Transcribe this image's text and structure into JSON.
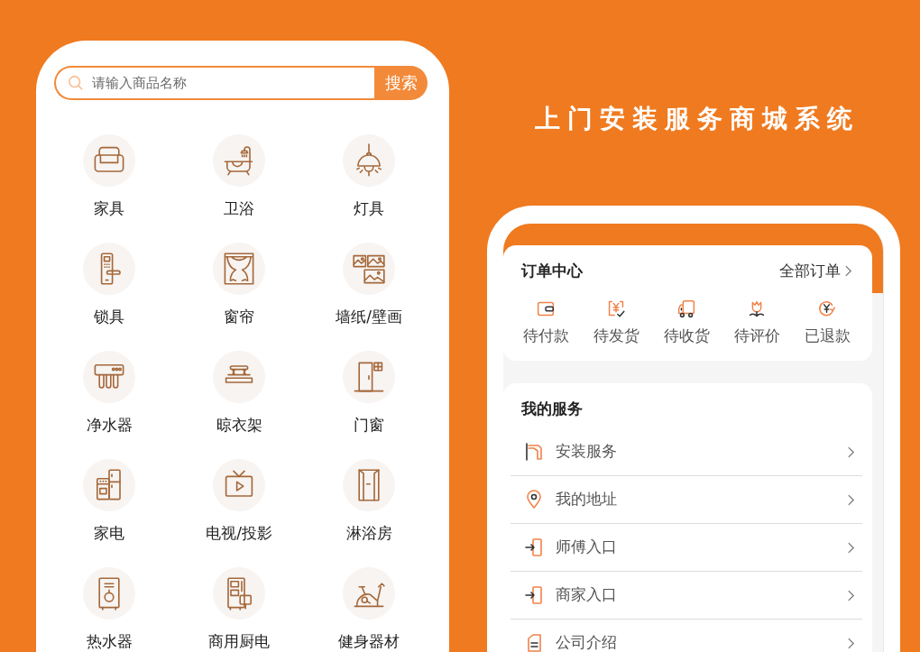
{
  "title": "上门安装服务商城系统",
  "shop_screen": {
    "search": {
      "placeholder": "请输入商品名称",
      "button": "搜索"
    },
    "categories": [
      "家具",
      "卫浴",
      "灯具",
      "锁具",
      "窗帘",
      "墙纸/壁画",
      "净水器",
      "晾衣架",
      "门窗",
      "家电",
      "电视/投影",
      "淋浴房",
      "热水器",
      "商用厨电",
      "健身器材"
    ]
  },
  "profile_screen": {
    "order_center": {
      "title": "订单中心",
      "all_orders": "全部订单",
      "statuses": [
        "待付款",
        "待发货",
        "待收货",
        "待评价",
        "已退款"
      ]
    },
    "services": {
      "title": "我的服务",
      "items": [
        "安装服务",
        "我的地址",
        "师傅入口",
        "商家入口",
        "公司介绍"
      ]
    }
  }
}
